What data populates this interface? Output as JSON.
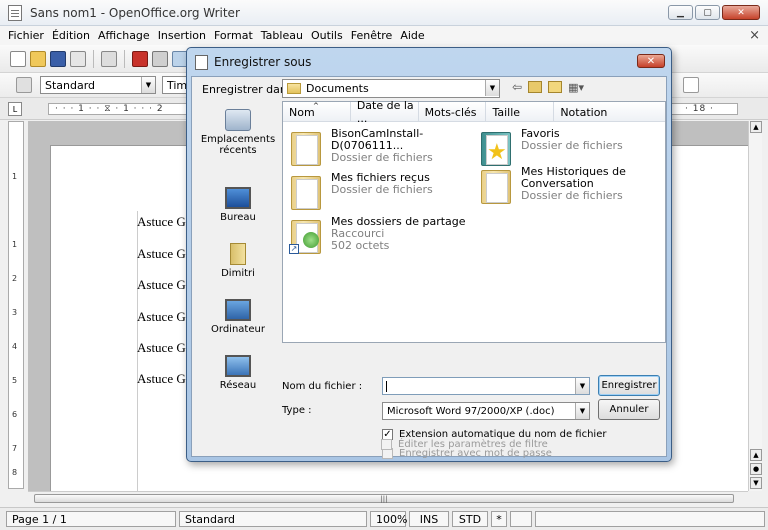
{
  "window": {
    "title": "Sans nom1 - OpenOffice.org Writer",
    "minimize": "▁",
    "maximize": "▢",
    "close": "✕"
  },
  "menu": [
    "Fichier",
    "Édition",
    "Affichage",
    "Insertion",
    "Format",
    "Tableau",
    "Outils",
    "Fenêtre",
    "Aide"
  ],
  "menu_close": "×",
  "formatbar": {
    "style": "Standard",
    "font": "Tim"
  },
  "ruler": {
    "h_marks": "· · · 1 · · ⧖ · 1 · · · 2",
    "h_right": "· 18 ·",
    "v_marks": [
      "1",
      "1",
      "2",
      "3",
      "4",
      "5",
      "6",
      "7",
      "8"
    ]
  },
  "document": {
    "lines": [
      "Astuce GNT",
      "Astuce GNT",
      "Astuce GNT",
      "Astuce GNT",
      "Astuce GNT",
      "Astuce GNT"
    ]
  },
  "status": {
    "page": "Page 1 / 1",
    "style": "Standard",
    "zoom": "100%",
    "ins": "INS",
    "std": "STD",
    "modified": "*"
  },
  "dialog": {
    "title": "Enregistrer sous",
    "close": "✕",
    "save_in_label": "Enregistrer dans :",
    "save_in_value": "Documents",
    "places": [
      {
        "label": "Emplacements récents",
        "icon": "recent-places-icon"
      },
      {
        "label": "Bureau",
        "icon": "desktop-icon"
      },
      {
        "label": "Dimitri",
        "icon": "user-folder-icon"
      },
      {
        "label": "Ordinateur",
        "icon": "computer-icon"
      },
      {
        "label": "Réseau",
        "icon": "network-icon"
      }
    ],
    "columns": [
      "Nom",
      "Date de la ...",
      "Mots-clés",
      "Taille",
      "Notation"
    ],
    "files": [
      {
        "name": "BisonCamInstall-D(0706111...",
        "type": "Dossier de fichiers",
        "icon": "folder-icon"
      },
      {
        "name": "Favoris",
        "type": "Dossier de fichiers",
        "icon": "favorites-folder-icon"
      },
      {
        "name": "Mes fichiers reçus",
        "type": "Dossier de fichiers",
        "icon": "folder-icon"
      },
      {
        "name": "Mes Historiques de Conversation",
        "type": "Dossier de fichiers",
        "icon": "folder-icon"
      },
      {
        "name": "Mes dossiers de partage",
        "type": "Raccourci",
        "size": "502 octets",
        "icon": "shared-folder-shortcut-icon"
      }
    ],
    "filename_label": "Nom du fichier :",
    "filename_value": "",
    "type_label": "Type :",
    "type_value": "Microsoft Word 97/2000/XP (.doc)",
    "save_button": "Enregistrer",
    "cancel_button": "Annuler",
    "options": [
      {
        "label": "Extension automatique du nom de fichier",
        "checked": true,
        "enabled": true
      },
      {
        "label": "Enregistrer avec mot de passe",
        "checked": false,
        "enabled": false
      },
      {
        "label": "Éditer les paramètres de filtre",
        "checked": false,
        "enabled": false
      }
    ]
  },
  "colors": {
    "dialog_frame": "#a9c5e4",
    "close_red": "#c5402a",
    "disabled_text": "#9a9a9a"
  }
}
